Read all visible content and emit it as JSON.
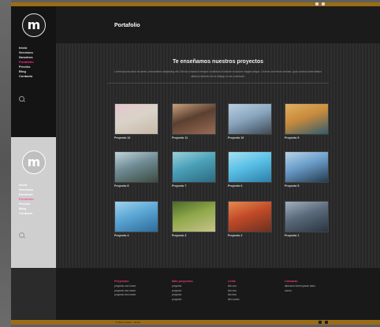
{
  "page": {
    "title": "Portafolio"
  },
  "sidebar": {
    "logo": "m",
    "items": [
      "Inicio",
      "Servicios",
      "Nosotros",
      "Portafolio",
      "Precios",
      "Blog",
      "Contacto"
    ],
    "active": "Portafolio"
  },
  "sidebar_alt": {
    "logo": "m",
    "items": [
      "Inicio",
      "Servicios",
      "Nosotros",
      "Portafolio",
      "Precios",
      "Blog",
      "Contacto"
    ],
    "active": "Portafolio"
  },
  "intro": {
    "title": "Te enseñamos nuestros proyectos",
    "text": "Lorem ipsum dolor sit amet, consectetur adipiscing elit. Sed do eiusmod tempor incididunt ut labore et dolore magna aliqua. Ut enim ad minim veniam, quis nostrud exercitation ullamco laboris nisi ut aliquip ex ea commodo."
  },
  "projects": [
    {
      "caption": "Proyecto 12",
      "colors": [
        "#d9d3c8",
        "#c7b9a8",
        "#e6c5cf"
      ]
    },
    {
      "caption": "Proyecto 11",
      "colors": [
        "#5a4030",
        "#9b6b55",
        "#c9a07e"
      ]
    },
    {
      "caption": "Proyecto 10",
      "colors": [
        "#8aa7c0",
        "#3e4a55",
        "#b9cfe0"
      ]
    },
    {
      "caption": "Proyecto 9",
      "colors": [
        "#c98a3c",
        "#2f5c6e",
        "#e0b060"
      ]
    },
    {
      "caption": "Proyecto 8",
      "colors": [
        "#6f8b94",
        "#3c4b40",
        "#c2d4da"
      ]
    },
    {
      "caption": "Proyecto 7",
      "colors": [
        "#4aa0b8",
        "#2d6a80",
        "#9bd0dc"
      ]
    },
    {
      "caption": "Proyecto 6",
      "colors": [
        "#5bc0e6",
        "#2b7fa8",
        "#a7e0f2"
      ]
    },
    {
      "caption": "Proyecto 5",
      "colors": [
        "#6a9cc8",
        "#243a4e",
        "#b8d4ea"
      ]
    },
    {
      "caption": "Proyecto 4",
      "colors": [
        "#5aa6d4",
        "#2d6a9a",
        "#9fd2ec"
      ]
    },
    {
      "caption": "Proyecto 3",
      "colors": [
        "#8fa84a",
        "#c9c38a",
        "#4d6a28"
      ]
    },
    {
      "caption": "Proyecto 2",
      "colors": [
        "#c14a28",
        "#6b3020",
        "#e58a50"
      ]
    },
    {
      "caption": "Proyecto 1",
      "colors": [
        "#5a6a7a",
        "#2a3440",
        "#a2b0be"
      ]
    }
  ],
  "footer": {
    "columns": [
      {
        "heading": "Proyectos",
        "links": [
          "proyecto uno lorem",
          "proyecto dos lorem",
          "proyecto tres lorem"
        ]
      },
      {
        "heading": "Mas proyectos",
        "links": [
          "proyecto",
          "proyecto",
          "proyecto",
          "proyecto"
        ]
      },
      {
        "heading": "Links",
        "links": [
          "link uno",
          "link dos",
          "link tres",
          "link cuatro"
        ]
      },
      {
        "heading": "Contacto",
        "links": [
          "direccion lorem ipsum dolor",
          "correo"
        ]
      }
    ],
    "copyright": "© 2014 medium · theme"
  },
  "theme": {
    "accent": "#9a6c16",
    "active_link": "#ff2f8a",
    "footer_heading": "#e33a7a"
  }
}
